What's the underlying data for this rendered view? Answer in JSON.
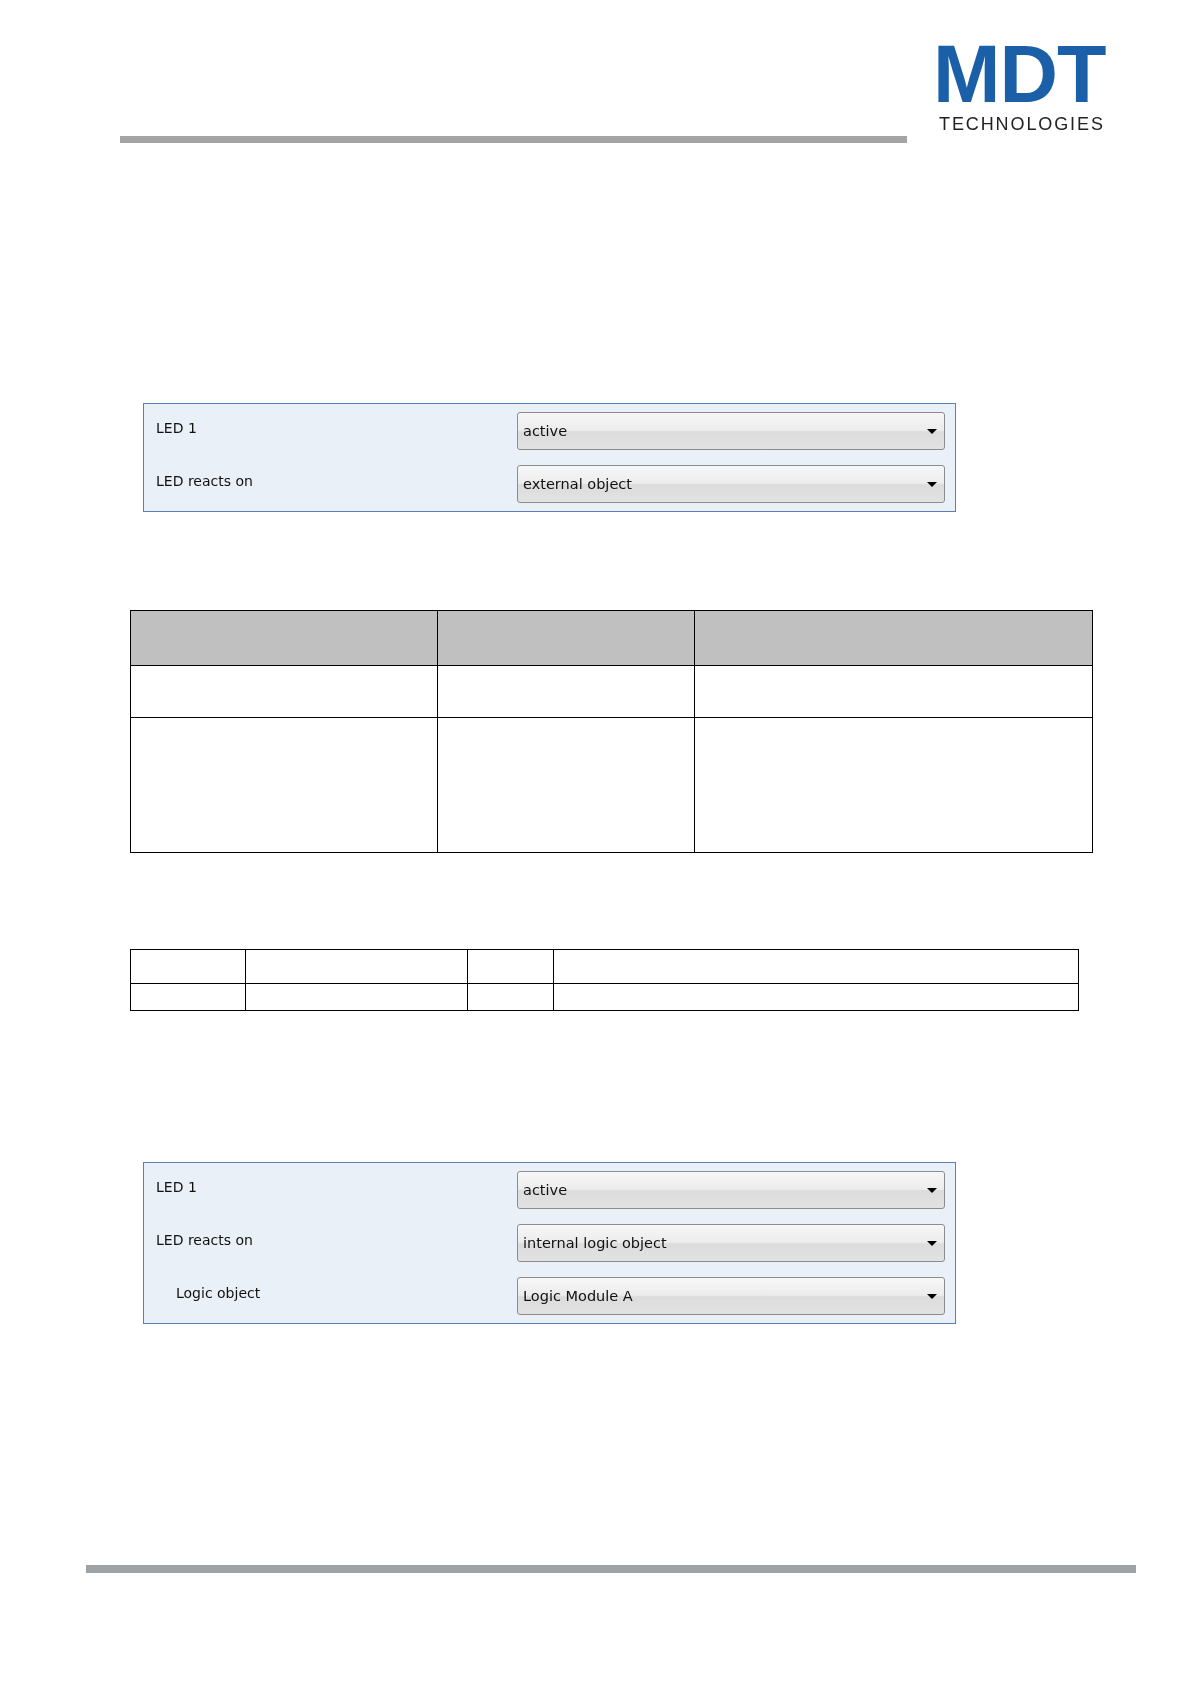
{
  "header": {
    "logo": {
      "wordmark": "MDT",
      "tagline": "TECHNOLOGIES"
    }
  },
  "settings_panels": [
    {
      "rows": [
        {
          "label": "LED 1",
          "value": "active"
        },
        {
          "label": "LED reacts on",
          "value": "external object"
        }
      ]
    },
    {
      "rows": [
        {
          "label": "LED 1",
          "value": "active"
        },
        {
          "label": "LED reacts on",
          "value": "internal logic object",
          "children": [
            {
              "label": "Logic object",
              "value": "Logic Module A"
            }
          ]
        }
      ]
    }
  ]
}
